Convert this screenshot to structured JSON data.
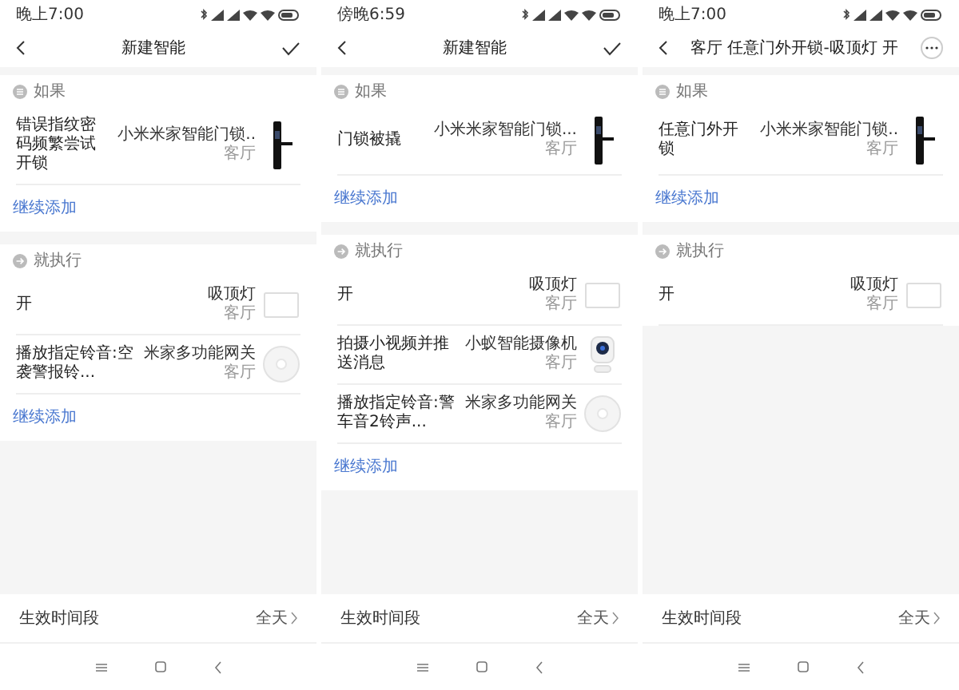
{
  "phones": [
    {
      "status_time": "晚上7:00",
      "title": "新建智能",
      "header_button": {
        "kind": "check"
      },
      "if_label": "如果",
      "triggers": [
        {
          "text": "错误指纹密码频繁尝试开锁",
          "device": "小米米家智能门锁..",
          "room": "客厅",
          "kind": "lock"
        }
      ],
      "add_trigger": "继续添加",
      "then_label": "就执行",
      "actions": [
        {
          "text": "开",
          "device": "吸顶灯",
          "room": "客厅",
          "kind": "light"
        },
        {
          "text": "播放指定铃音:空袭警报铃...",
          "device": "米家多功能网关",
          "room": "客厅",
          "kind": "hub"
        }
      ],
      "add_action": "继续添加",
      "time_label": "生效时间段",
      "time_value": "全天"
    },
    {
      "status_time": "傍晚6:59",
      "title": "新建智能",
      "header_button": {
        "kind": "check"
      },
      "if_label": "如果",
      "triggers": [
        {
          "text": "门锁被撬",
          "device": "小米米家智能门锁...",
          "room": "客厅",
          "kind": "lock"
        }
      ],
      "add_trigger": "继续添加",
      "then_label": "就执行",
      "actions": [
        {
          "text": "开",
          "device": "吸顶灯",
          "room": "客厅",
          "kind": "light"
        },
        {
          "text": "拍摄小视频并推送消息",
          "device": "小蚁智能摄像机",
          "room": "客厅",
          "kind": "camera"
        },
        {
          "text": "播放指定铃音:警车音2铃声...",
          "device": "米家多功能网关",
          "room": "客厅",
          "kind": "hub"
        }
      ],
      "add_action": "继续添加",
      "time_label": "生效时间段",
      "time_value": "全天"
    },
    {
      "status_time": "晚上7:00",
      "title": "客厅 任意门外开锁-吸顶灯 开",
      "header_button": {
        "kind": "more"
      },
      "if_label": "如果",
      "triggers": [
        {
          "text": "任意门外开锁",
          "device": "小米米家智能门锁..",
          "room": "客厅",
          "kind": "lock"
        }
      ],
      "add_trigger": "继续添加",
      "then_label": "就执行",
      "actions": [
        {
          "text": "开",
          "device": "吸顶灯",
          "room": "客厅",
          "kind": "light"
        }
      ],
      "time_label": "生效时间段",
      "time_value": "全天"
    }
  ]
}
